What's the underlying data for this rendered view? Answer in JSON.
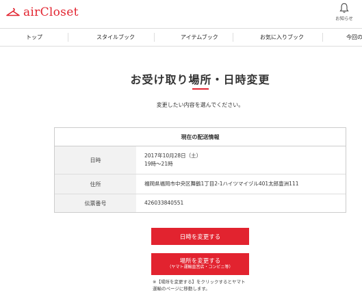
{
  "header": {
    "logo_text": "airCloset",
    "notice_label": "お知らせ",
    "brand_color": "#e2232f"
  },
  "nav": {
    "items": [
      {
        "label": "トップ"
      },
      {
        "label": "スタイルブック"
      },
      {
        "label": "アイテムブック"
      },
      {
        "label": "お気に入りブック"
      },
      {
        "label": "今回の"
      }
    ]
  },
  "main": {
    "title": "お受け取り場所・日時変更",
    "subtitle": "変更したい内容を選んでください。"
  },
  "delivery_info": {
    "heading": "現在の配送情報",
    "rows": [
      {
        "label": "日時",
        "values": [
          "2017年10月28日（土）",
          "19時〜21時"
        ]
      },
      {
        "label": "住所",
        "values": [
          "福岡県福岡市中央区舞鶴1丁目2-1ハイツマイヅル401太郎豊洲111"
        ]
      },
      {
        "label": "伝票番号",
        "values": [
          "426033840551"
        ]
      }
    ]
  },
  "buttons": {
    "change_date": "日時を変更する",
    "change_place": "場所を変更する",
    "change_place_sub": "（ヤマト運輸直営店・コンビニ等）"
  },
  "note": {
    "line1": "※【場所を変更する】をクリックするとヤマト",
    "line2": "運輸のページに移動します。"
  }
}
